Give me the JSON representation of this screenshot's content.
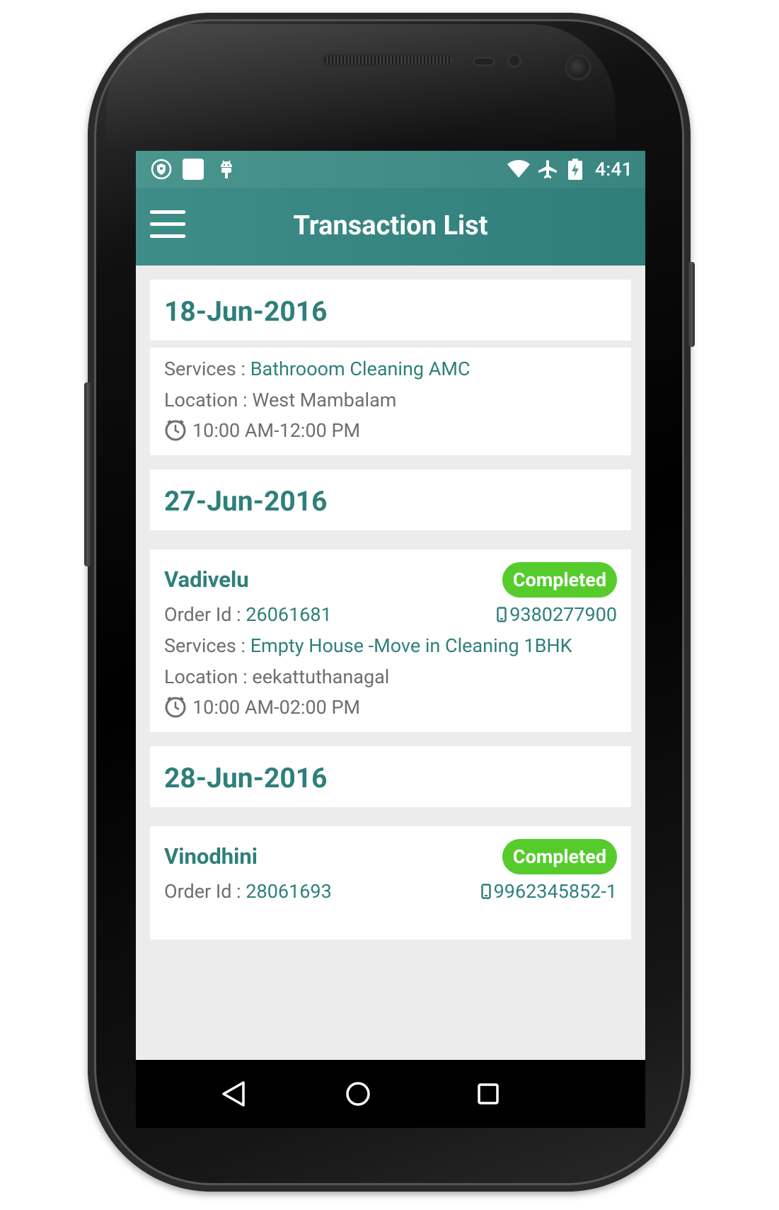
{
  "status_bar": {
    "time": "4:41"
  },
  "app_bar": {
    "title": "Transaction List"
  },
  "labels": {
    "services": "Services : ",
    "location": "Location : ",
    "order_id": "Order Id : "
  },
  "groups": [
    {
      "date": "18-Jun-2016",
      "entry": {
        "services": "Bathrooom Cleaning AMC",
        "location": "West Mambalam",
        "time": "10:00 AM-12:00 PM"
      }
    },
    {
      "date": "27-Jun-2016",
      "entry": {
        "name": "Vadivelu",
        "status": "Completed",
        "order_id": "26061681",
        "phone": "9380277900",
        "services": "Empty House -Move in Cleaning 1BHK",
        "location": "eekattuthanagal",
        "time": "10:00 AM-02:00 PM"
      }
    },
    {
      "date": "28-Jun-2016",
      "entry": {
        "name": "Vinodhini",
        "status": "Completed",
        "order_id": "28061693",
        "phone": "9962345852-1"
      }
    }
  ],
  "colors": {
    "primary": "#2e7f7a",
    "status_completed": "#55cc2c",
    "background": "#ececec"
  }
}
